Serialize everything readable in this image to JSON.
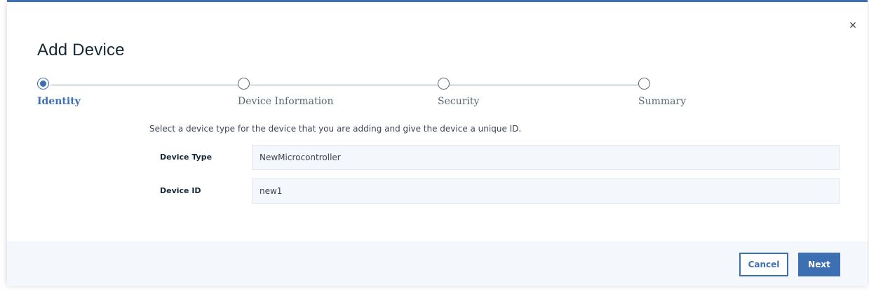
{
  "dialog": {
    "title": "Add Device",
    "close_glyph": "×",
    "accent_color": "#3d70b2"
  },
  "stepper": {
    "steps": [
      {
        "label": "Identity",
        "state": "active"
      },
      {
        "label": "Device Information",
        "state": "pending"
      },
      {
        "label": "Security",
        "state": "pending"
      },
      {
        "label": "Summary",
        "state": "pending"
      }
    ]
  },
  "form": {
    "description": "Select a device type for the device that you are adding and give the device a unique ID.",
    "device_type": {
      "label": "Device Type",
      "value": "NewMicrocontroller"
    },
    "device_id": {
      "label": "Device ID",
      "value": "new1"
    }
  },
  "footer": {
    "cancel_label": "Cancel",
    "next_label": "Next"
  }
}
